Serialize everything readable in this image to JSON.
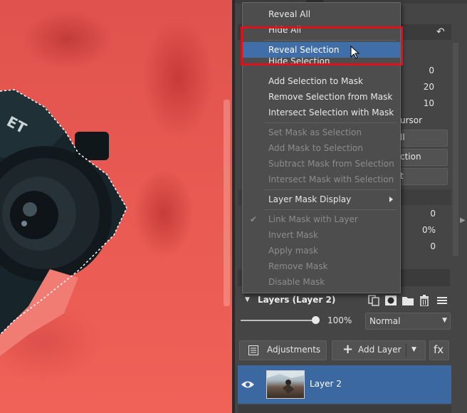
{
  "context_menu": {
    "items": [
      {
        "label": "Reveal All",
        "enabled": true
      },
      {
        "label": "Hide All",
        "enabled": true
      },
      {
        "label": "Reveal Selection",
        "enabled": true,
        "highlighted": true
      },
      {
        "label": "Hide Selection",
        "enabled": true
      },
      {
        "label": "Add Selection to Mask",
        "enabled": true
      },
      {
        "label": "Remove Selection from Mask",
        "enabled": true
      },
      {
        "label": "Intersect Selection with Mask",
        "enabled": true
      },
      {
        "label": "Set Mask as Selection",
        "enabled": false
      },
      {
        "label": "Add Mask to Selection",
        "enabled": false
      },
      {
        "label": "Subtract Mask from Selection",
        "enabled": false
      },
      {
        "label": "Intersect Mask with Selection",
        "enabled": false
      },
      {
        "label": "Layer Mask Display",
        "enabled": true,
        "submenu": true
      },
      {
        "label": "Link Mask with Layer",
        "enabled": false,
        "checked": true
      },
      {
        "label": "Invert Mask",
        "enabled": false
      },
      {
        "label": "Apply mask",
        "enabled": false
      },
      {
        "label": "Remove Mask",
        "enabled": false
      },
      {
        "label": "Disable Mask",
        "enabled": false
      }
    ]
  },
  "panel_behind": {
    "values_group1": [
      "0",
      "20",
      "10"
    ],
    "label_cursor": "ursor",
    "button_all": "ll",
    "button_ction": "ction",
    "button_t": "t",
    "values_group2": [
      "0",
      "0%",
      "0"
    ]
  },
  "layers": {
    "title": "Layers (Layer 2)",
    "opacity": "100%",
    "opacity_value": 1.0,
    "blend_mode": "Normal",
    "adjustments_label": "Adjustments",
    "add_layer_label": "Add Layer",
    "fx_label": "fx",
    "layer_name": "Layer 2"
  },
  "colors": {
    "highlight": "#3f6ea8",
    "annotation_box": "#e0111b",
    "layer_selected": "#3c68a2"
  }
}
